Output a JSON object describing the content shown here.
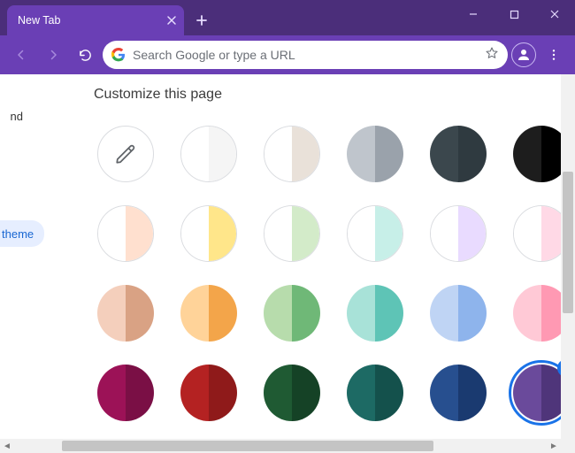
{
  "window": {
    "tab_title": "New Tab",
    "min_icon": "minimize-icon",
    "max_icon": "maximize-icon",
    "close_icon": "close-icon"
  },
  "toolbar": {
    "back_icon": "back-icon",
    "forward_icon": "forward-icon",
    "reload_icon": "reload-icon",
    "search_placeholder": "Search Google or type a URL",
    "star_icon": "star-icon",
    "profile_icon": "profile-icon",
    "menu_icon": "menu-icon"
  },
  "dialog": {
    "title": "Customize this page",
    "side_fragment_1": "nd",
    "side_fragment_2": "theme"
  },
  "swatches": [
    {
      "id": "custom-picker",
      "type": "picker"
    },
    {
      "id": "white",
      "l": "#ffffff",
      "r": "#f5f5f5",
      "outline": true
    },
    {
      "id": "warm-grey",
      "l": "#ffffff",
      "r": "#e9e1d9",
      "outline": true
    },
    {
      "id": "cool-grey",
      "l": "#bfc5cc",
      "r": "#9aa2ab"
    },
    {
      "id": "slate",
      "l": "#3b474d",
      "r": "#2f3a40"
    },
    {
      "id": "black",
      "l": "#1d1d1d",
      "r": "#000000"
    },
    {
      "id": "peach-light",
      "l": "#ffffff",
      "r": "#ffe0cf",
      "outline": true
    },
    {
      "id": "yellow-light",
      "l": "#ffffff",
      "r": "#ffe68a",
      "outline": true
    },
    {
      "id": "green-light",
      "l": "#ffffff",
      "r": "#d3ebc9",
      "outline": true
    },
    {
      "id": "teal-light",
      "l": "#ffffff",
      "r": "#c7efe8",
      "outline": true
    },
    {
      "id": "lavender-light",
      "l": "#ffffff",
      "r": "#e9dbff",
      "outline": true
    },
    {
      "id": "pink-light",
      "l": "#ffffff",
      "r": "#ffd9e6",
      "outline": true
    },
    {
      "id": "peach",
      "l": "#f4cfbc",
      "r": "#d9a284"
    },
    {
      "id": "orange",
      "l": "#ffd399",
      "r": "#f3a54a"
    },
    {
      "id": "green",
      "l": "#b7dcac",
      "r": "#6fb877"
    },
    {
      "id": "teal",
      "l": "#a8e2d8",
      "r": "#5ec4b6"
    },
    {
      "id": "blue",
      "l": "#bfd4f4",
      "r": "#8eb4ec"
    },
    {
      "id": "pink",
      "l": "#ffc9d6",
      "r": "#ff99b3"
    },
    {
      "id": "magenta",
      "l": "#9c1257",
      "r": "#7a0f45"
    },
    {
      "id": "red",
      "l": "#b42222",
      "r": "#8f1a1a"
    },
    {
      "id": "forest",
      "l": "#1f5a33",
      "r": "#154226"
    },
    {
      "id": "deep-teal",
      "l": "#1d6a64",
      "r": "#14514c"
    },
    {
      "id": "navy",
      "l": "#274f8f",
      "r": "#1a3a70"
    },
    {
      "id": "purple",
      "l": "#6a4a9b",
      "r": "#4f357a",
      "selected": true
    }
  ]
}
